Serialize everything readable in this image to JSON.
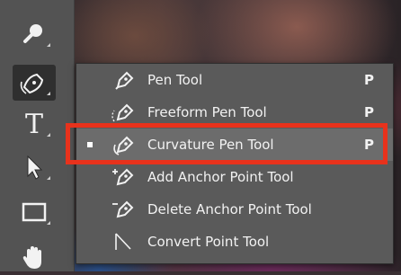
{
  "toolbar": {
    "tools": [
      {
        "name": "search-tool",
        "icon": "magnifier-icon"
      },
      {
        "name": "pen-tool-group",
        "icon": "pen-tool-icon",
        "active": true
      },
      {
        "name": "type-tool",
        "icon": "type-icon",
        "glyph": "T"
      },
      {
        "name": "path-selection-tool",
        "icon": "arrow-cursor-icon"
      },
      {
        "name": "rectangle-tool",
        "icon": "rectangle-icon"
      },
      {
        "name": "hand-tool",
        "icon": "hand-icon"
      }
    ]
  },
  "flyout": {
    "items": [
      {
        "label": "Pen Tool",
        "shortcut": "P",
        "icon": "pen-icon",
        "selected": false
      },
      {
        "label": "Freeform Pen Tool",
        "shortcut": "P",
        "icon": "freeform-pen-icon",
        "selected": false
      },
      {
        "label": "Curvature Pen Tool",
        "shortcut": "P",
        "icon": "curvature-pen-icon",
        "selected": true
      },
      {
        "label": "Add Anchor Point Tool",
        "shortcut": "",
        "icon": "add-anchor-point-icon",
        "selected": false
      },
      {
        "label": "Delete Anchor Point Tool",
        "shortcut": "",
        "icon": "delete-anchor-point-icon",
        "selected": false
      },
      {
        "label": "Convert Point Tool",
        "shortcut": "",
        "icon": "convert-point-icon",
        "selected": false
      }
    ]
  },
  "colors": {
    "highlight": "#e8321c",
    "menu_bg": "#5a5a5a",
    "toolbar_bg": "#535353"
  }
}
